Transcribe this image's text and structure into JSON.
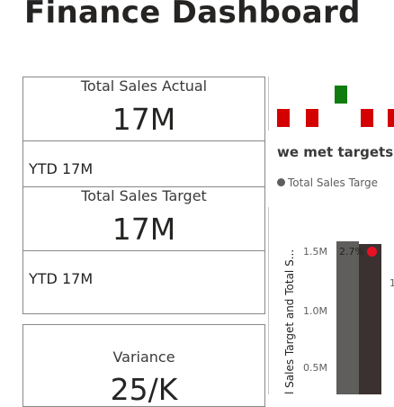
{
  "page": {
    "title": "Finance Dashboard"
  },
  "cards": [
    {
      "label": "Total Sales Actual",
      "value": "17M",
      "ytd": "YTD  17M"
    },
    {
      "label": "Total Sales Target",
      "value": "17M",
      "ytd": "YTD  17M"
    },
    {
      "label": "Variance",
      "value": "25/K"
    }
  ],
  "indicator": {
    "colors": {
      "green": "#107c10",
      "red": "#d40000"
    },
    "text": "we met targets"
  },
  "chart": {
    "legend_label": "Total Sales Targe",
    "yaxis_title": "l Sales Target and Total S...",
    "ticks": [
      "1.5M",
      "1.0M",
      "0.5M"
    ],
    "right_tick": "1",
    "pct_label": "2.7%",
    "colors": {
      "bar1": "#605e5c",
      "bar2": "#3b3131",
      "marker": "#e81123"
    }
  }
}
